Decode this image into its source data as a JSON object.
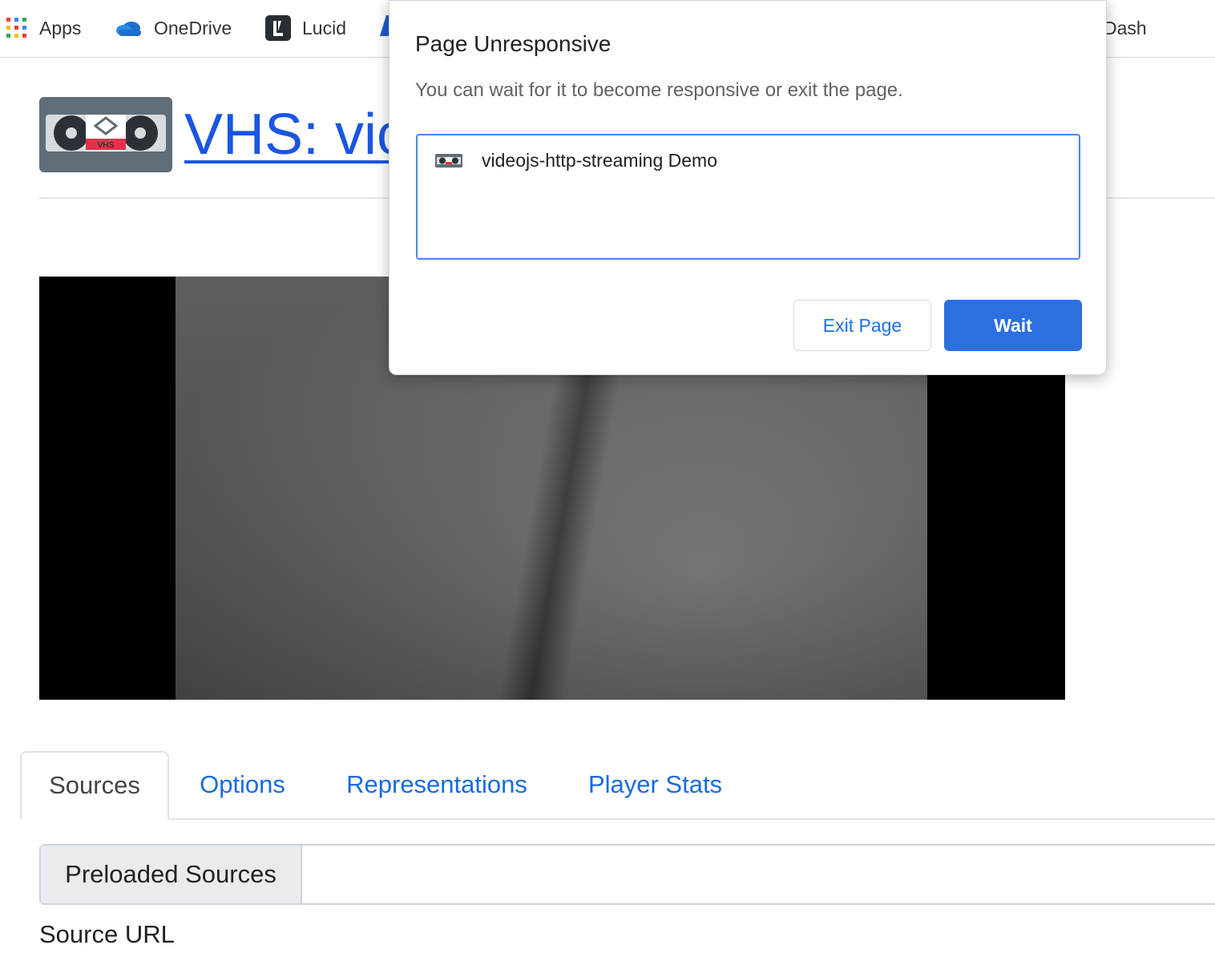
{
  "bookmarks": {
    "apps": "Apps",
    "onedrive": "OneDrive",
    "lucid": "Lucid",
    "dash": "Dash"
  },
  "header": {
    "title": "VHS: vic",
    "logo_text": "VHS"
  },
  "tabs": [
    {
      "label": "Sources",
      "active": true
    },
    {
      "label": "Options",
      "active": false
    },
    {
      "label": "Representations",
      "active": false
    },
    {
      "label": "Player Stats",
      "active": false
    }
  ],
  "sources": {
    "preloaded_label": "Preloaded Sources",
    "source_url_label": "Source URL"
  },
  "dialog": {
    "title": "Page Unresponsive",
    "message": "You can wait for it to become responsive or exit the page.",
    "page_item": "videojs-http-streaming Demo",
    "exit_label": "Exit Page",
    "wait_label": "Wait"
  },
  "colors": {
    "link": "#1a6be0",
    "primary_button": "#2b6fe0",
    "focus_border": "#4a86e8"
  }
}
